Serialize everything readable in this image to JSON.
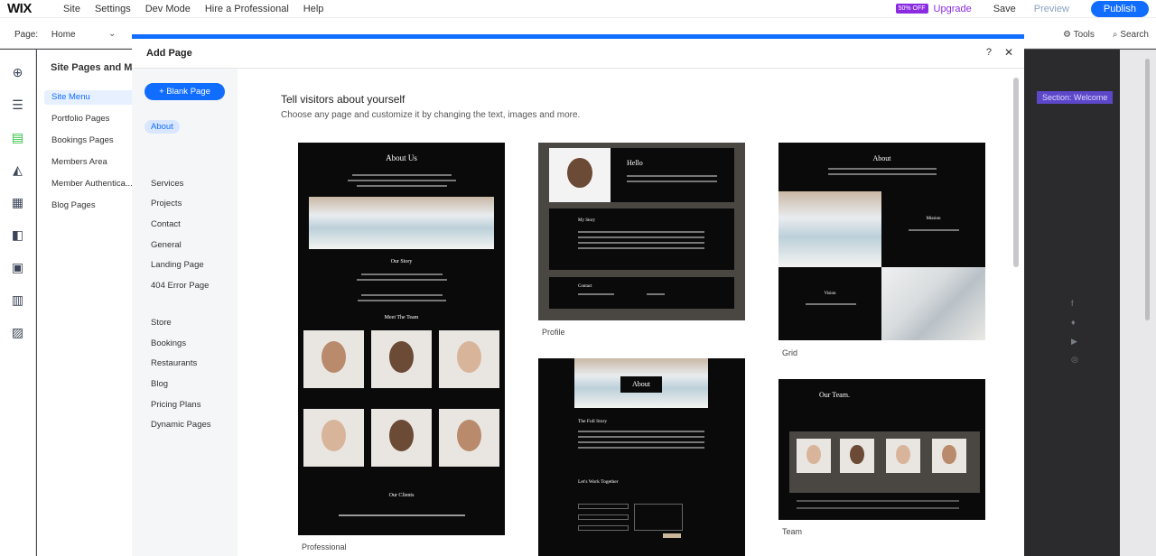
{
  "topbar": {
    "logo": "WIX",
    "menu": [
      "Site",
      "Settings",
      "Dev Mode",
      "Hire a Professional",
      "Help"
    ],
    "badge": "50% OFF",
    "upgrade": "Upgrade",
    "save": "Save",
    "preview": "Preview",
    "publish": "Publish"
  },
  "secondbar": {
    "page_label": "Page:",
    "page_value": "Home",
    "tools_label": "Tools",
    "search_label": "Search"
  },
  "site_panel": {
    "title": "Site Pages and Me",
    "items": [
      "Site Menu",
      "Portfolio Pages",
      "Bookings Pages",
      "Members Area",
      "Member Authentica...",
      "Blog Pages"
    ]
  },
  "canvas": {
    "section_label": "Section: Welcome"
  },
  "modal": {
    "title": "Add Page",
    "help": "?",
    "close": "✕",
    "blank_button": "+ Blank Page",
    "categories_top": [
      "About",
      "Services",
      "Projects",
      "Contact",
      "General",
      "Landing Page",
      "404 Error Page"
    ],
    "categories_bottom": [
      "Store",
      "Bookings",
      "Restaurants",
      "Blog",
      "Pricing Plans",
      "Dynamic Pages"
    ],
    "heading": "Tell visitors about yourself",
    "subheading": "Choose any page and customize it by changing the text, images and more.",
    "templates": {
      "professional": {
        "label": "Professional",
        "about_us": "About Us",
        "our_story": "Our Story",
        "meet_team": "Meet The Team",
        "our_clients": "Our Clients"
      },
      "profile": {
        "label": "Profile",
        "hello": "Hello",
        "my_story": "My Story",
        "contact": "Contact"
      },
      "grid": {
        "label": "Grid",
        "about": "About",
        "mission": "Mission",
        "vision": "Vision"
      },
      "about_full": {
        "about": "About",
        "full_story": "The Full Story",
        "work_together": "Let's Work Together"
      },
      "team": {
        "label": "Team",
        "our_team": "Our Team."
      }
    }
  }
}
